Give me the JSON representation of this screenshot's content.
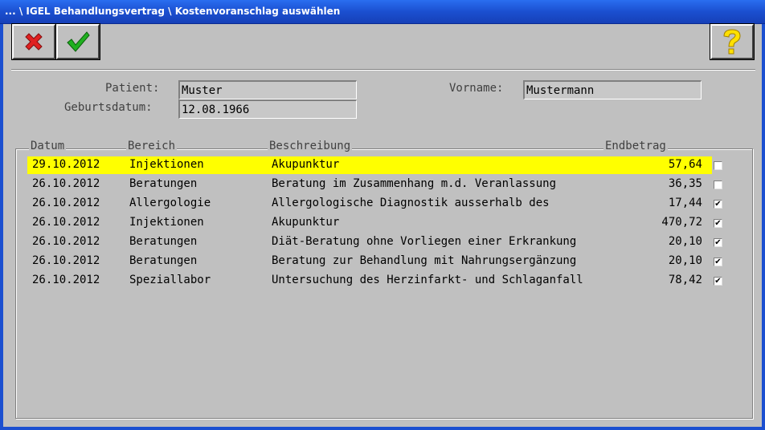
{
  "window": {
    "title": "... \\ IGEL Behandlungsvertrag \\ Kostenvoranschlag auswählen"
  },
  "toolbar": {
    "cancel_icon": "cancel-x-icon",
    "ok_icon": "checkmark-icon",
    "help_icon": "question-mark-icon"
  },
  "patient": {
    "patient_label": "Patient:",
    "patient_value": "Muster",
    "birth_label": "Geburtsdatum:",
    "birth_value": "12.08.1966",
    "firstname_label": "Vorname:",
    "firstname_value": "Mustermann"
  },
  "table": {
    "headers": {
      "date": "Datum",
      "area": "Bereich",
      "desc": "Beschreibung",
      "amount": "Endbetrag"
    },
    "rows": [
      {
        "date": "29.10.2012",
        "area": "Injektionen",
        "desc": "Akupunktur",
        "amount": "57,64",
        "checked": false,
        "selected": true
      },
      {
        "date": "26.10.2012",
        "area": "Beratungen",
        "desc": "Beratung im Zusammenhang m.d. Veranlassung",
        "amount": "36,35",
        "checked": false,
        "selected": false
      },
      {
        "date": "26.10.2012",
        "area": "Allergologie",
        "desc": "Allergologische Diagnostik ausserhalb des",
        "amount": "17,44",
        "checked": true,
        "selected": false
      },
      {
        "date": "26.10.2012",
        "area": "Injektionen",
        "desc": "Akupunktur",
        "amount": "470,72",
        "checked": true,
        "selected": false
      },
      {
        "date": "26.10.2012",
        "area": "Beratungen",
        "desc": "Diät-Beratung ohne Vorliegen einer Erkrankung",
        "amount": "20,10",
        "checked": true,
        "selected": false
      },
      {
        "date": "26.10.2012",
        "area": "Beratungen",
        "desc": "Beratung zur Behandlung mit Nahrungsergänzung",
        "amount": "20,10",
        "checked": true,
        "selected": false
      },
      {
        "date": "26.10.2012",
        "area": "Speziallabor",
        "desc": "Untersuchung des Herzinfarkt- und Schlaganfall",
        "amount": "78,42",
        "checked": true,
        "selected": false
      }
    ]
  },
  "colors": {
    "highlight": "#ffff00",
    "titlebar": "#1b4fd0",
    "background": "#c0c0c0"
  }
}
